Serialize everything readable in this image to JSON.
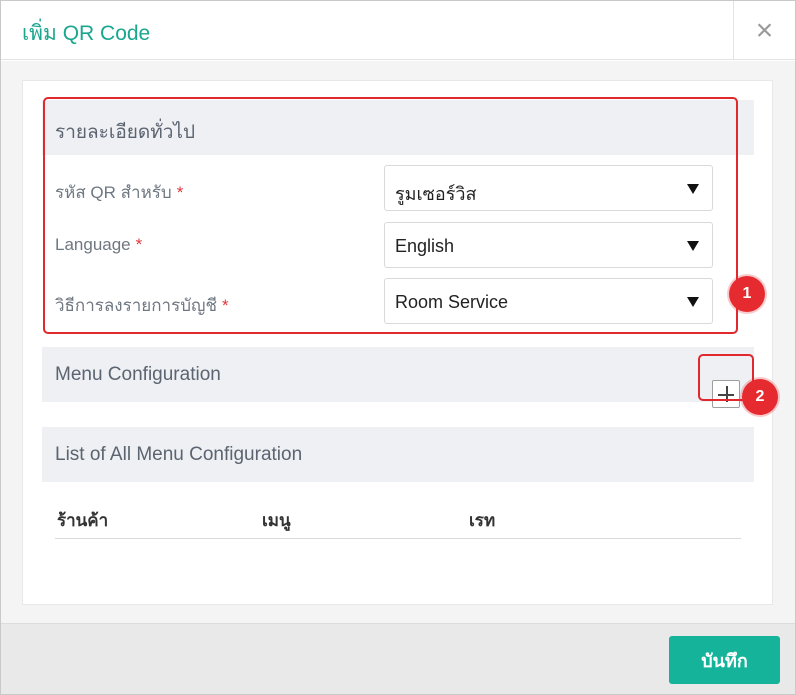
{
  "modal": {
    "title": "เพิ่ม QR Code",
    "close_label": "×"
  },
  "general_section": {
    "title": "รายละเอียดทั่วไป",
    "fields": [
      {
        "label": "รหัส QR สำหรับ",
        "required_mark": "*",
        "value": "รูมเซอร์วิส"
      },
      {
        "label": "Language",
        "required_mark": "*",
        "value": "English"
      },
      {
        "label": "วิธีการลงรายการบัญชี",
        "required_mark": "*",
        "value": "Room Service"
      }
    ]
  },
  "menu_config_section": {
    "title": "Menu Configuration",
    "add_icon": "plus-icon"
  },
  "list_section": {
    "title": "List of All Menu Configuration",
    "columns": [
      "ร้านค้า",
      "เมนู",
      "เรท"
    ]
  },
  "annotations": {
    "badge_1": "1",
    "badge_2": "2",
    "color": "#e52b2f"
  },
  "footer": {
    "save_label": "บันทึก"
  },
  "colors": {
    "accent": "#15b49a",
    "title": "#1aa68f",
    "required": "#e0383e"
  }
}
